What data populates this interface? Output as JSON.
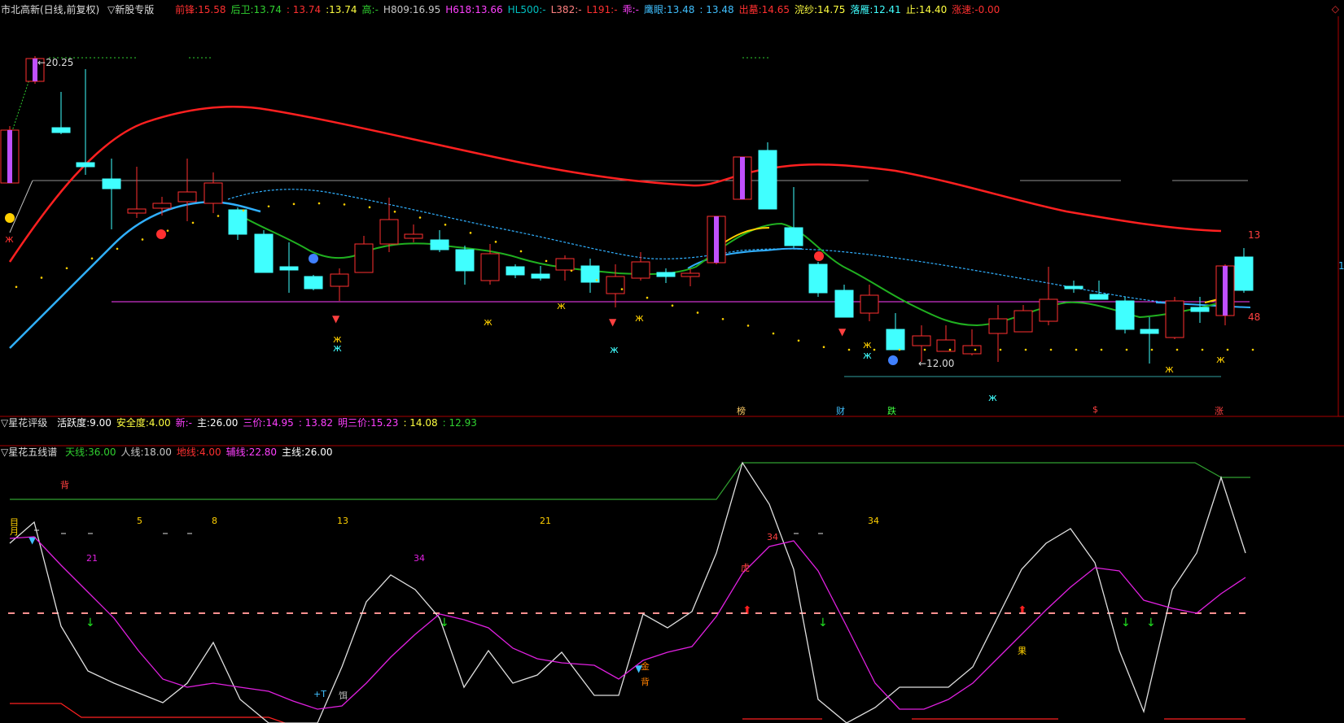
{
  "header": {
    "stock_title": "市北高新(日线,前复权)",
    "menu_label": "新股专版",
    "items": [
      {
        "label": "前锋:",
        "value": "15.58",
        "color": "#ff3030"
      },
      {
        "label": "后卫:",
        "value": "13.74",
        "color": "#30d030"
      },
      {
        "label": "",
        "value": ": 13.74",
        "color": "#ff3030"
      },
      {
        "label": "",
        "value": ":13.74",
        "color": "#ffff40"
      },
      {
        "label": "高:",
        "value": "-",
        "color": "#30d030"
      },
      {
        "label": "H809:",
        "value": "16.95",
        "color": "#c8c8c8"
      },
      {
        "label": "H618:",
        "value": "13.66",
        "color": "#ff40ff"
      },
      {
        "label": "HL500:",
        "value": "-",
        "color": "#00c0c0"
      },
      {
        "label": "L382:",
        "value": "-",
        "color": "#ff8080"
      },
      {
        "label": "L191:",
        "value": "-",
        "color": "#ff3030"
      },
      {
        "label": "乖:",
        "value": "-",
        "color": "#ff40ff"
      },
      {
        "label": "鹰眼:",
        "value": "13.48",
        "color": "#40c0ff"
      },
      {
        "label": "",
        "value": ": 13.48",
        "color": "#40c0ff"
      },
      {
        "label": "出墓:",
        "value": "14.65",
        "color": "#ff3030"
      },
      {
        "label": "浣纱:",
        "value": "14.75",
        "color": "#ffff40"
      },
      {
        "label": "落雁:",
        "value": "12.41",
        "color": "#40ffff"
      },
      {
        "label": "止:",
        "value": "14.40",
        "color": "#ffff40"
      },
      {
        "label": "涨速:",
        "value": "-0.00",
        "color": "#ff3030"
      }
    ],
    "corner_icon": "diamond-icon"
  },
  "main_chart": {
    "labels": {
      "high": "20.25",
      "low": "←12.00",
      "right_13": "13",
      "right_48": "48",
      "right_edge": "1"
    },
    "markers": [
      {
        "text": "榜",
        "color": "#ffcc66"
      },
      {
        "text": "财",
        "color": "#40c0ff"
      },
      {
        "text": "跌",
        "color": "#40ff40"
      },
      {
        "text": "$",
        "color": "#ff4040"
      },
      {
        "text": "涨",
        "color": "#ff4040"
      }
    ]
  },
  "panel2": {
    "title": "星花评级",
    "items": [
      {
        "label": "活跃度:",
        "value": "9.00",
        "color": "#ffffff"
      },
      {
        "label": "安全度:",
        "value": "4.00",
        "color": "#ffff40"
      },
      {
        "label": "新:",
        "value": "-",
        "color": "#ff40ff"
      },
      {
        "label": "主:",
        "value": "26.00",
        "color": "#ffffff"
      },
      {
        "label": "三价:",
        "value": "14.95",
        "color": "#ff40ff"
      },
      {
        "label": "",
        "value": ": 13.82",
        "color": "#ff40ff"
      },
      {
        "label": "明三价:",
        "value": "15.23",
        "color": "#ff40ff"
      },
      {
        "label": "",
        "value": ": 14.08",
        "color": "#ffff40"
      },
      {
        "label": "",
        "value": ": 12.93",
        "color": "#30d030"
      }
    ]
  },
  "panel3": {
    "title": "星花五线谱",
    "items": [
      {
        "label": "天线:",
        "value": "36.00",
        "color": "#30d030"
      },
      {
        "label": "人线:",
        "value": "18.00",
        "color": "#c8c8c8"
      },
      {
        "label": "地线:",
        "value": "4.00",
        "color": "#ff3030"
      },
      {
        "label": "辅线:",
        "value": "22.80",
        "color": "#ff40ff"
      },
      {
        "label": "主线:",
        "value": "26.00",
        "color": "#ffffff"
      }
    ],
    "texts": {
      "bei1": "背",
      "mu": "目",
      "yue": "月",
      "fib": [
        "5",
        "8",
        "13",
        "21",
        "34"
      ],
      "n21a": "21",
      "n34a": "34",
      "n34b": "34",
      "hu": "虎",
      "guo": "果",
      "jin": "金",
      "bei2": "背",
      "t": "+T",
      "er": "饵"
    }
  },
  "colors": {
    "up": "#ff3030",
    "down": "#40ffff",
    "bg": "#000000",
    "separator": "#aa0000"
  }
}
